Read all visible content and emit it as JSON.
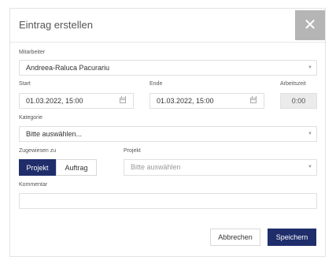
{
  "dialog": {
    "title": "Eintrag erstellen",
    "close_symbol": "✕"
  },
  "form": {
    "mitarbeiter_label": "Mitarbeiter",
    "mitarbeiter_value": "Andreea-Raluca Pacurariu",
    "start_label": "Start",
    "start_value": "01.03.2022, 15:00",
    "ende_label": "Ende",
    "ende_value": "01.03.2022, 15:00",
    "arbeitszeit_label": "Arbeitszeit",
    "arbeitszeit_value": "0:00",
    "kategorie_label": "Kategorie",
    "kategorie_value": "Bitte auswählen...",
    "zugewiesen_label": "Zugewiesen zu",
    "zugewiesen_options": [
      "Projekt",
      "Auftrag"
    ],
    "projekt_label": "Projekt",
    "projekt_placeholder": "Bitte auswählen",
    "kommentar_label": "Kommentar",
    "kommentar_value": ""
  },
  "footer": {
    "cancel_label": "Abbrechen",
    "save_label": "Speichern"
  },
  "icons": {
    "caret": "▼",
    "calendar": "calendar-icon",
    "close": "close-icon"
  },
  "colors": {
    "primary": "#1f2d6b",
    "close_bg": "#b5b5b5"
  }
}
